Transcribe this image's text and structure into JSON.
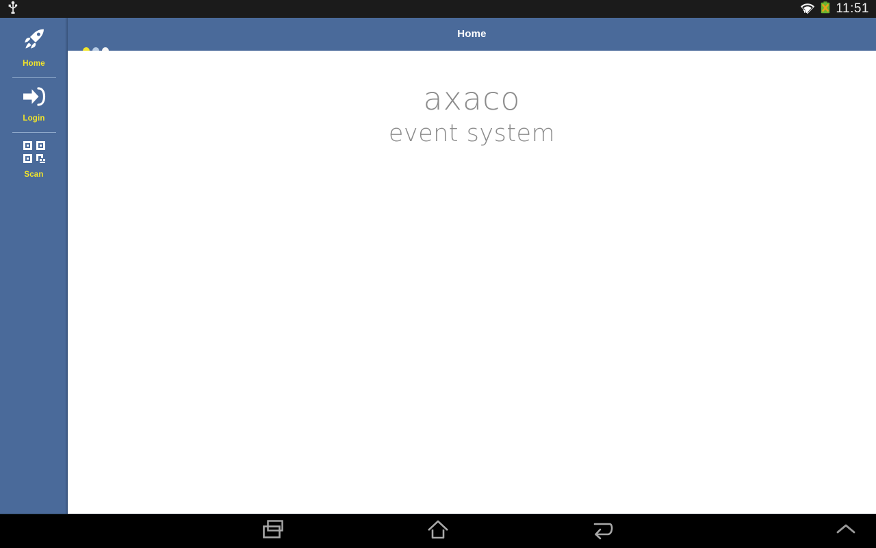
{
  "status_bar": {
    "usb_icon": "usb-icon",
    "wifi_icon": "wifi-signal-icon",
    "battery_icon": "battery-unknown-icon",
    "clock": "11:51",
    "background_color": "#1b1b1b"
  },
  "sidebar": {
    "background_color": "#4a6a9a",
    "label_color": "#f2e52a",
    "items": [
      {
        "label": "Home",
        "icon": "rocket-icon"
      },
      {
        "label": "Login",
        "icon": "sign-in-icon"
      },
      {
        "label": "Scan",
        "icon": "qr-code-icon"
      }
    ]
  },
  "header": {
    "title": "Home",
    "background_color": "#4a6a9a",
    "title_color": "#ffffff",
    "loader": {
      "name": "loading-dots",
      "dots": [
        "#f2e52a",
        "#b8cce4",
        "#f5f5f5"
      ]
    }
  },
  "content": {
    "background_color": "#ffffff",
    "brand_name": "axaco",
    "brand_tagline": "event system",
    "brand_color": "#8c8c8c"
  },
  "nav_bar": {
    "background_color": "#000000",
    "buttons": [
      {
        "name": "recent-apps-button",
        "icon": "recent-apps-icon"
      },
      {
        "name": "home-button",
        "icon": "home-icon"
      },
      {
        "name": "back-button",
        "icon": "back-arrow-icon"
      },
      {
        "name": "expand-button",
        "icon": "chevron-up-icon"
      }
    ]
  }
}
